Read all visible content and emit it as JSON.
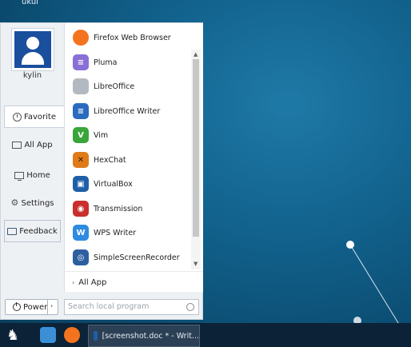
{
  "desktop": {
    "label": "ukui"
  },
  "user": {
    "name": "kylin"
  },
  "sidebar": {
    "items": [
      {
        "label": "Favorite",
        "icon": "clock-icon",
        "active": true
      },
      {
        "label": "All App",
        "icon": "grid-icon"
      },
      {
        "label": "Home",
        "icon": "monitor-icon"
      },
      {
        "label": "Settings",
        "icon": "gear-icon"
      },
      {
        "label": "Feedback",
        "icon": "chat-icon"
      }
    ]
  },
  "apps": [
    {
      "name": "Firefox Web Browser",
      "color": "#f4731f",
      "glyph": ""
    },
    {
      "name": "Pluma",
      "color": "#8a6fd6",
      "glyph": ""
    },
    {
      "name": "LibreOffice",
      "color": "#9aa3ad",
      "glyph": ""
    },
    {
      "name": "LibreOffice Writer",
      "color": "#2a6bbd",
      "glyph": "≡"
    },
    {
      "name": "Vim",
      "color": "#3aa53a",
      "glyph": "V"
    },
    {
      "name": "HexChat",
      "color": "#e07b1a",
      "glyph": "✕"
    },
    {
      "name": "VirtualBox",
      "color": "#1f5fa8",
      "glyph": ""
    },
    {
      "name": "Transmission",
      "color": "#c9302c",
      "glyph": ""
    },
    {
      "name": "WPS Writer",
      "color": "#2f8be0",
      "glyph": "W"
    },
    {
      "name": "SimpleScreenRecorder",
      "color": "#2d5fa0",
      "glyph": ""
    }
  ],
  "all_app": {
    "label": "All App"
  },
  "power": {
    "label": "Power"
  },
  "search": {
    "placeholder": "Search local program"
  },
  "taskbar": {
    "window_label": "[screenshot.doc * - Writ..."
  },
  "colors": {
    "menu_bg": "#f2f3f5",
    "taskbar_bg": "#0c2236",
    "avatar_bg": "#1a4f9d"
  }
}
